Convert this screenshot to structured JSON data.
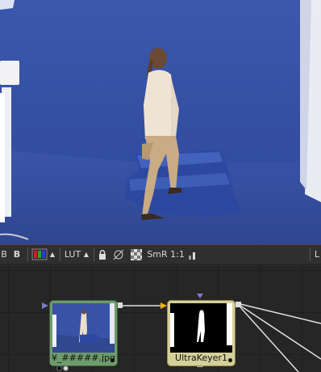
{
  "toolbar": {
    "lock_b_label": "B",
    "b_label": "B",
    "lut_label": "LUT",
    "smr_label": "SmR",
    "zoom_label": "1:1",
    "right_label": "L"
  },
  "nodes": [
    {
      "id": "loader",
      "label": "¥_#####.jpg",
      "color": "#6e9b6b"
    },
    {
      "id": "ultrakeyer",
      "label": "UltraKeyer1",
      "color": "#d6cf9a"
    }
  ],
  "colors": {
    "bluescreen": "#3650a4",
    "accent": "#f0b000"
  }
}
